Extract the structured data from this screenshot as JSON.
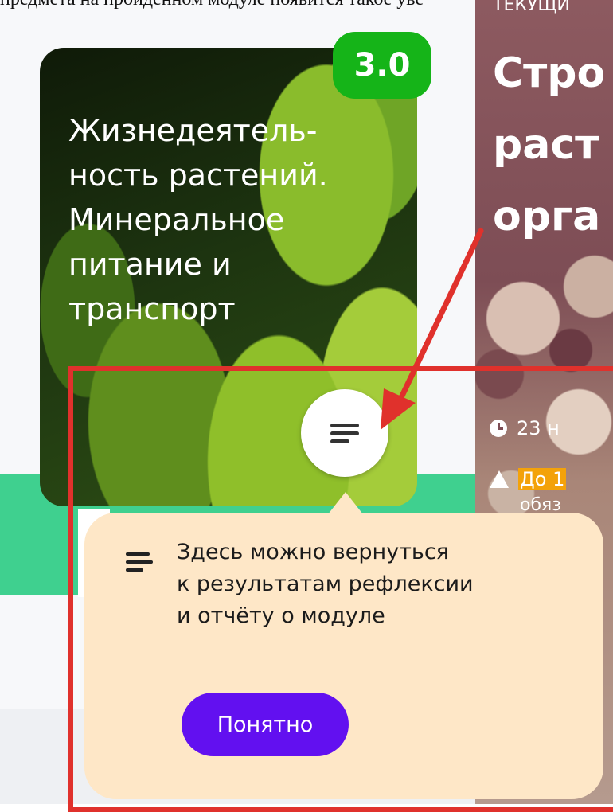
{
  "top_text": "предмета на пройденном модуле появится такое уве",
  "module_card": {
    "version": "3.0",
    "title_lines": [
      "Жизнедеятель-",
      "ность растений.",
      "Минеральное",
      "питание и",
      "транспорт"
    ]
  },
  "next_card": {
    "top_label": "ТЕКУЩИ",
    "title_lines": [
      "Стро",
      "раст",
      "орга"
    ],
    "date_text": "23 н",
    "warning_highlight": "До 1",
    "warning_rest": "обяз"
  },
  "tooltip": {
    "lines": [
      "Здесь можно вернуться",
      "к результатам рефлексии",
      "и отчёту о модуле"
    ],
    "button_label": "Понятно"
  },
  "colors": {
    "badge_green": "#15b418",
    "band_green": "#3fd08f",
    "tooltip_bg": "#fee7c7",
    "button_purple": "#6210f0",
    "annotation_red": "#e0312c"
  },
  "icons": [
    "menu-icon",
    "clock-icon",
    "warning-icon",
    "arrow-annotation"
  ]
}
